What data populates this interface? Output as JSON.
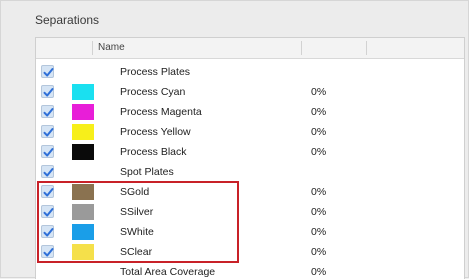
{
  "panel": {
    "title": "Separations",
    "column_name": "Name"
  },
  "rows": [
    {
      "name": "Process Plates",
      "checked": true,
      "swatch": null,
      "coverage": ""
    },
    {
      "name": "Process Cyan",
      "checked": true,
      "swatch": "#1ae0f0",
      "coverage": "0%"
    },
    {
      "name": "Process Magenta",
      "checked": true,
      "swatch": "#e81ed8",
      "coverage": "0%"
    },
    {
      "name": "Process Yellow",
      "checked": true,
      "swatch": "#f7ef1a",
      "coverage": "0%"
    },
    {
      "name": "Process Black",
      "checked": true,
      "swatch": "#0a0a0a",
      "coverage": "0%"
    },
    {
      "name": "Spot Plates",
      "checked": true,
      "swatch": null,
      "coverage": ""
    },
    {
      "name": "SGold",
      "checked": true,
      "swatch": "#8a7250",
      "coverage": "0%"
    },
    {
      "name": "SSilver",
      "checked": true,
      "swatch": "#9a9a9a",
      "coverage": "0%"
    },
    {
      "name": "SWhite",
      "checked": true,
      "swatch": "#1a9ee8",
      "coverage": "0%"
    },
    {
      "name": "SClear",
      "checked": true,
      "swatch": "#f5e04a",
      "coverage": "0%"
    },
    {
      "name": "Total Area Coverage",
      "checked": false,
      "swatch": null,
      "coverage": "0%"
    }
  ],
  "colors": {
    "highlight_border": "#c82128",
    "checkbox_fill": "#d5e4f4",
    "checkmark": "#2e6fd8"
  },
  "icons": {
    "checkbox": "checkmark-icon"
  }
}
